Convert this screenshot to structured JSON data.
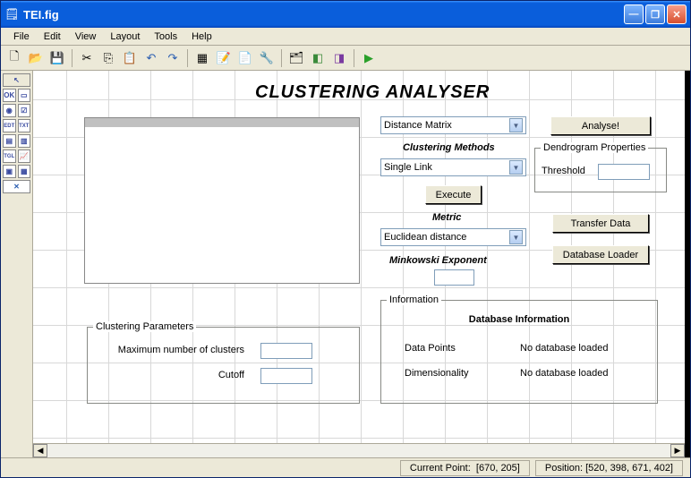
{
  "window": {
    "title": "TEI.fig"
  },
  "menu": {
    "file": "File",
    "edit": "Edit",
    "view": "View",
    "layout": "Layout",
    "tools": "Tools",
    "help": "Help"
  },
  "heading": "CLUSTERING ANALYSER",
  "dist": {
    "label": "Distance Matrix"
  },
  "methods": {
    "heading": "Clustering Methods",
    "value": "Single Link",
    "execute": "Execute"
  },
  "metric": {
    "heading": "Metric",
    "value": "Euclidean distance",
    "mink": "Minkowski Exponent"
  },
  "analyse": "Analyse!",
  "transfer": "Transfer Data",
  "loader": "Database Loader",
  "dendro": {
    "legend": "Dendrogram Properties",
    "threshold": "Threshold"
  },
  "clust": {
    "legend": "Clustering Parameters",
    "max": "Maximum number of clusters",
    "cutoff": "Cutoff"
  },
  "info": {
    "legend": "Information",
    "title": "Database Information",
    "dp": "Data Points",
    "dim": "Dimensionality",
    "none": "No database loaded"
  },
  "status": {
    "cp_label": "Current Point:",
    "cp_val": "[670, 205]",
    "pos_label": "Position:",
    "pos_val": "[520, 398, 671, 402]"
  }
}
